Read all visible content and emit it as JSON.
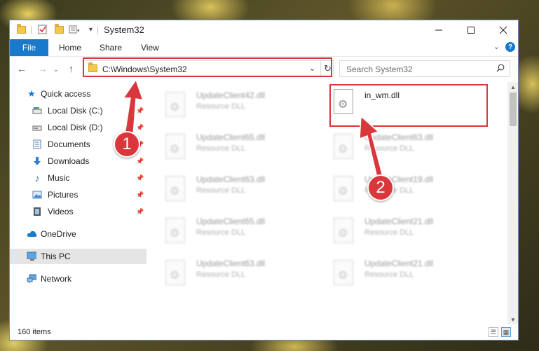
{
  "window": {
    "title": "System32"
  },
  "ribbon": {
    "file": "File",
    "home": "Home",
    "share": "Share",
    "view": "View",
    "help": "?"
  },
  "address": {
    "path": "C:\\Windows\\System32",
    "search_placeholder": "Search System32"
  },
  "nav": {
    "quick_access": "Quick access",
    "items": [
      {
        "label": "Local Disk (C:)",
        "icon": "drive-icon",
        "pinned": true
      },
      {
        "label": "Local Disk (D:)",
        "icon": "drive-icon",
        "pinned": true
      },
      {
        "label": "Documents",
        "icon": "documents-icon",
        "pinned": true
      },
      {
        "label": "Downloads",
        "icon": "downloads-icon",
        "pinned": true
      },
      {
        "label": "Music",
        "icon": "music-icon",
        "pinned": true
      },
      {
        "label": "Pictures",
        "icon": "pictures-icon",
        "pinned": true
      },
      {
        "label": "Videos",
        "icon": "videos-icon",
        "pinned": true
      }
    ],
    "onedrive": "OneDrive",
    "this_pc": "This PC",
    "network": "Network"
  },
  "files": {
    "left": [
      {
        "name": "UpdateClient42.dll",
        "type": "Resource DLL"
      },
      {
        "name": "UpdateClient65.dll",
        "type": "Resource DLL"
      },
      {
        "name": "UpdateClient63.dll",
        "type": "Resource DLL"
      },
      {
        "name": "UpdateClient65.dll",
        "type": "Resource DLL"
      },
      {
        "name": "UpdateClient63.dll",
        "type": "Resource DLL"
      }
    ],
    "right": [
      {
        "name": "in_wm.dll",
        "type": ""
      },
      {
        "name": "UpdateClient63.dll",
        "type": "Resource DLL"
      },
      {
        "name": "UpdateClient19.dll",
        "type": "Resource DLL"
      },
      {
        "name": "UpdateClient21.dll",
        "type": "Resource DLL"
      },
      {
        "name": "UpdateClient21.dll",
        "type": "Resource DLL"
      }
    ]
  },
  "status": {
    "count": "160 items"
  },
  "callouts": {
    "one": "1",
    "two": "2"
  },
  "colors": {
    "accent": "#1979ca",
    "highlight": "#d9373b"
  }
}
